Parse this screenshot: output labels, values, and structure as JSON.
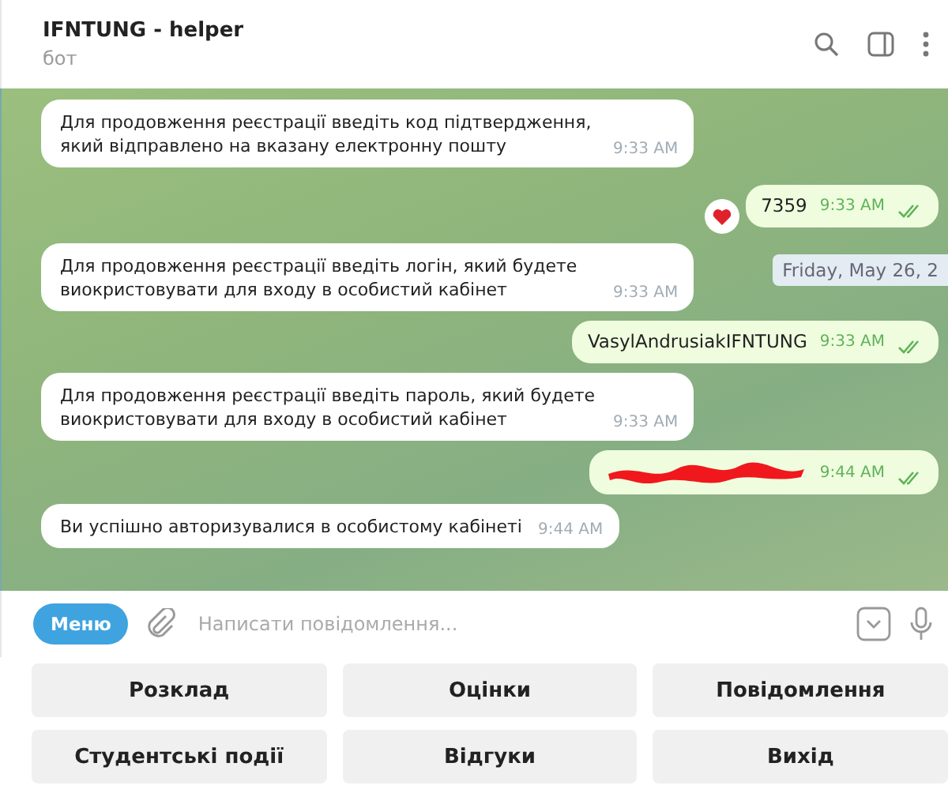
{
  "header": {
    "title": "IFNTUNG - helper",
    "subtitle": "бот"
  },
  "date_badge": "Friday, May 26, 2",
  "messages": [
    {
      "kind": "incoming",
      "text": "Для продовження реєстрації введіть код підтвердження, який відправлено на вказану електронну пошту",
      "time": "9:33 AM"
    },
    {
      "kind": "outgoing",
      "text": "7359",
      "time": "9:33 AM",
      "read": true,
      "reaction": true
    },
    {
      "kind": "incoming",
      "text": "Для продовження реєстрації введіть логін, який будете виокристовувати для входу в особистий кабінет",
      "time": "9:33 AM"
    },
    {
      "kind": "outgoing",
      "text": "VasylAndrusiakIFNTUNG",
      "time": "9:33 AM",
      "read": true,
      "reaction": false
    },
    {
      "kind": "incoming",
      "text": "Для продовження реєстрації введіть пароль, який будете виокристовувати для входу в особистий кабінет",
      "time": "9:33 AM"
    },
    {
      "kind": "redacted",
      "time": "9:44 AM",
      "read": true,
      "reaction": false
    },
    {
      "kind": "incoming",
      "text": "Ви успішно авторизувалися в особистому кабінеті",
      "time": "9:44 AM"
    }
  ],
  "composer": {
    "menu_button": "Меню",
    "placeholder": "Написати повідомлення..."
  },
  "keyboard": [
    [
      "Розклад",
      "Оцінки",
      "Повідомлення"
    ],
    [
      "Студентські події",
      "Відгуки",
      "Вихід"
    ]
  ]
}
